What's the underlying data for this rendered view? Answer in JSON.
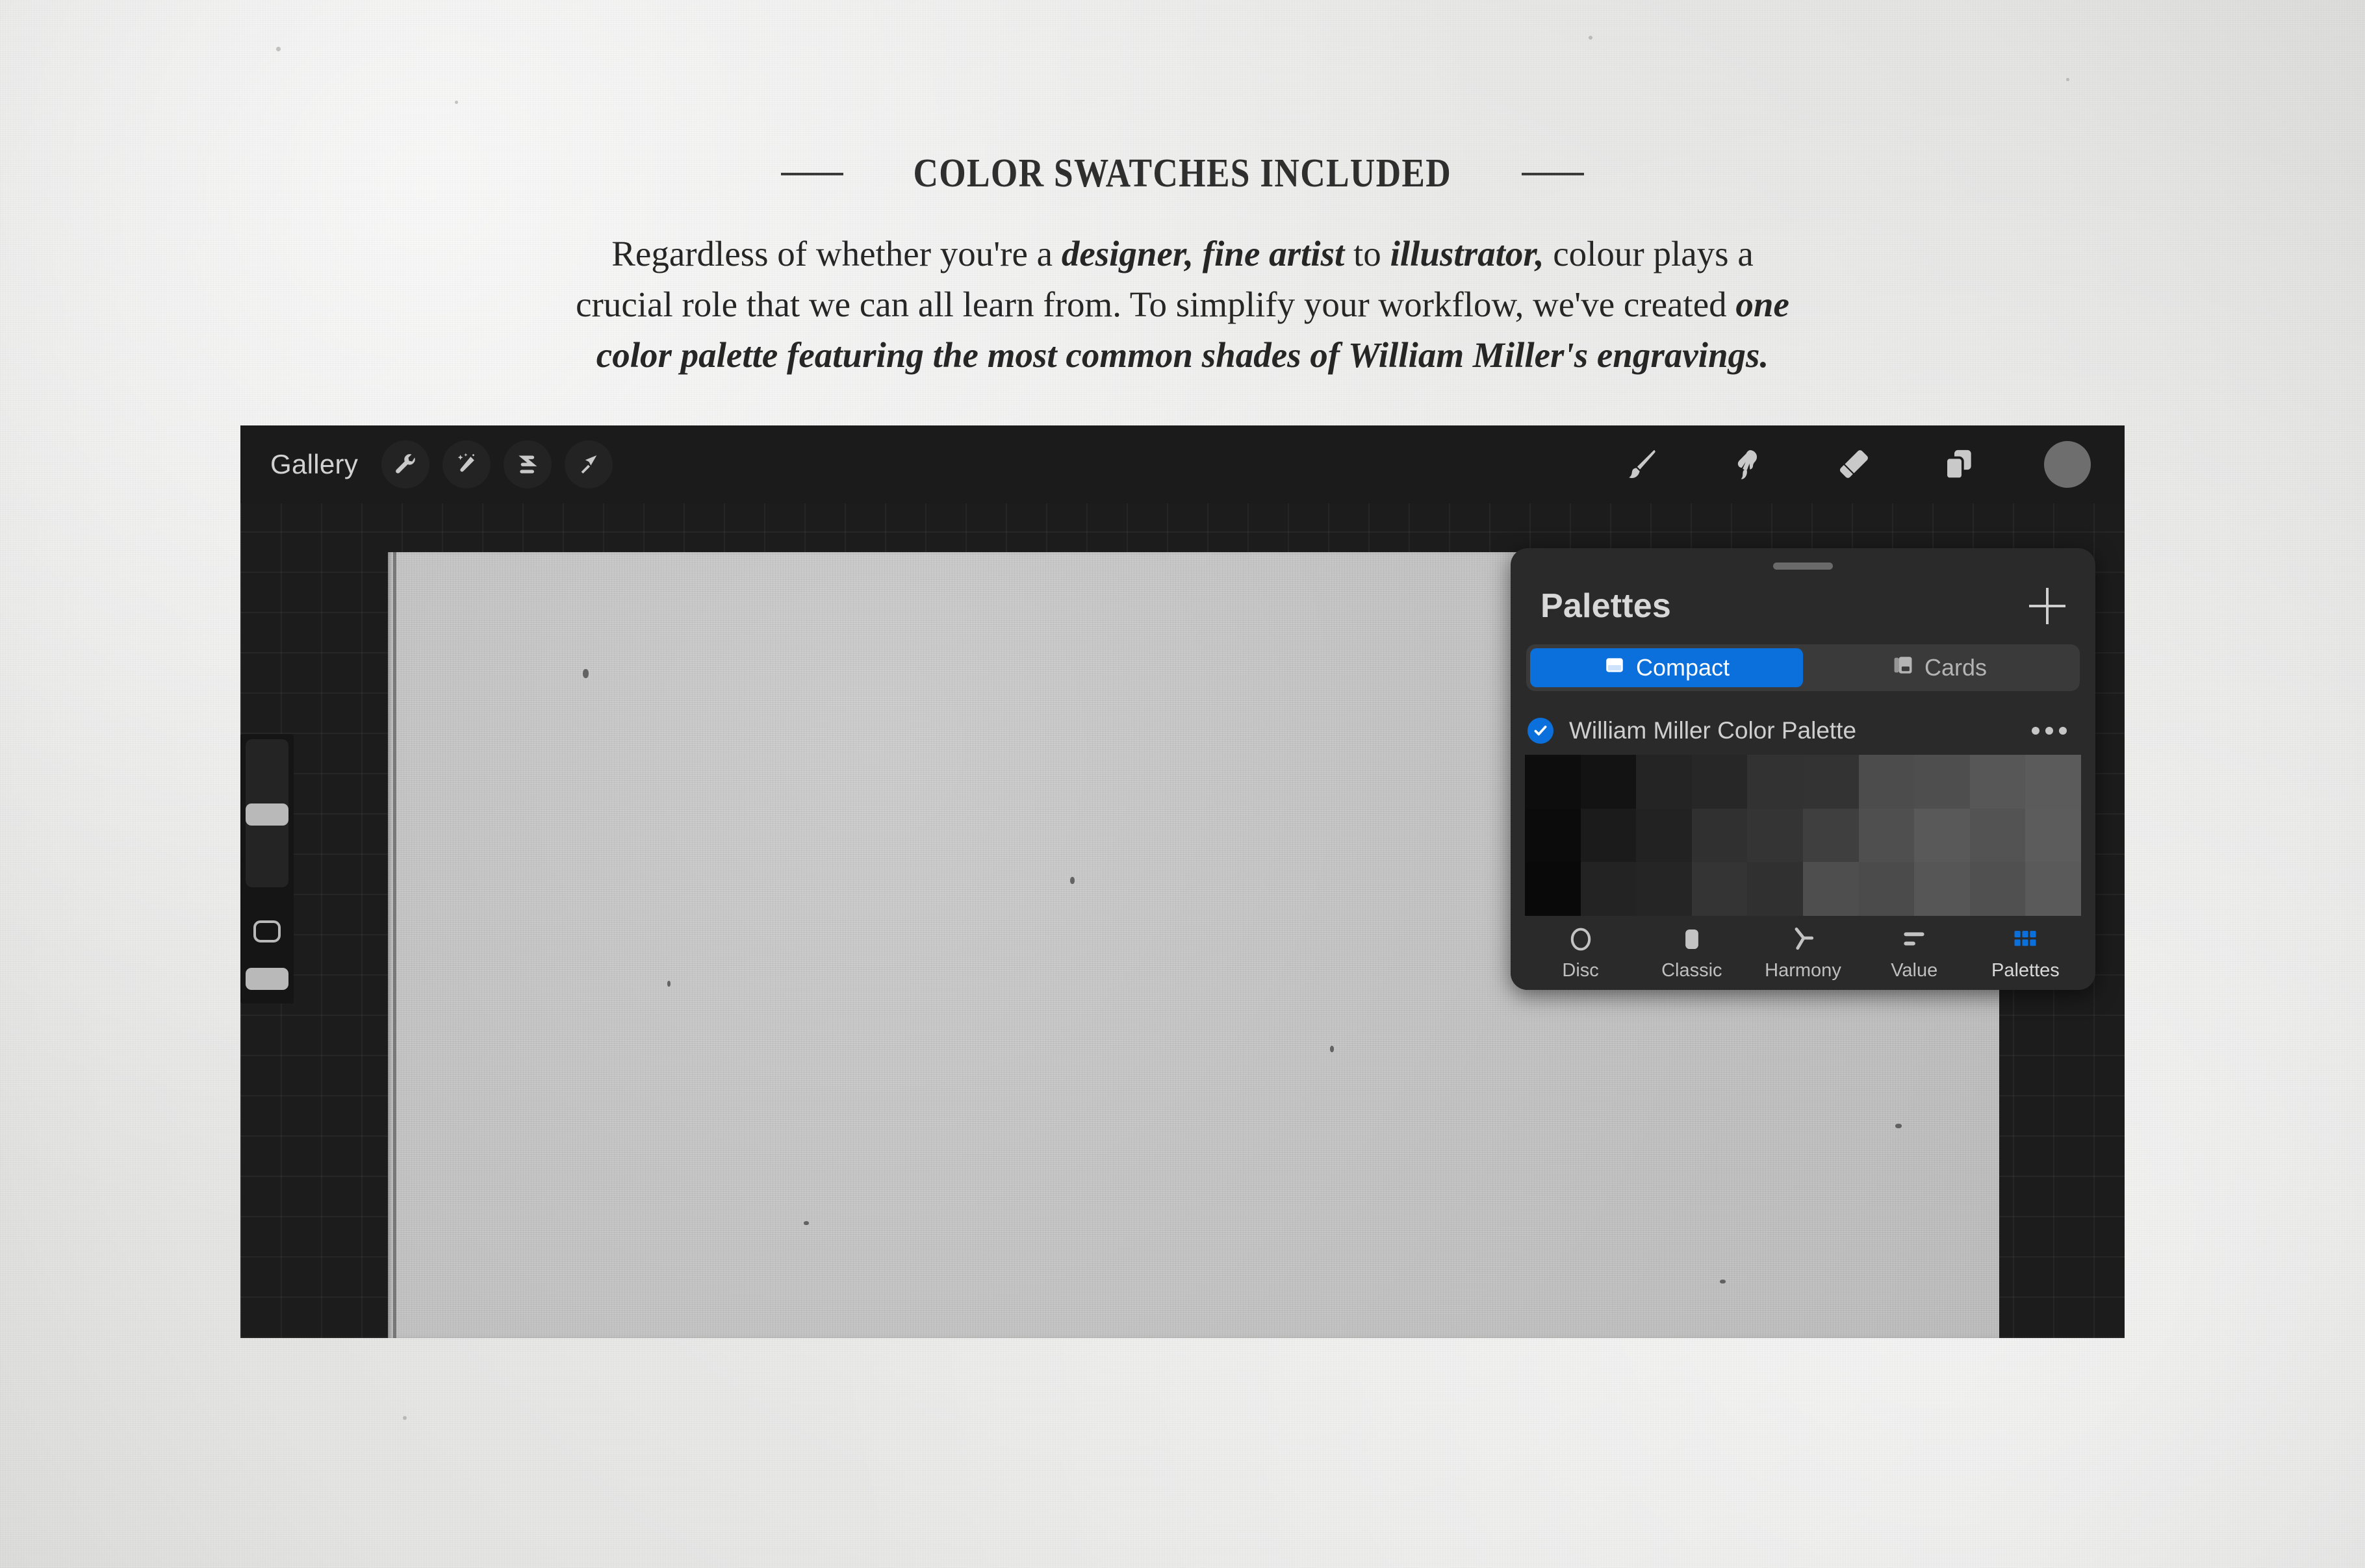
{
  "section": {
    "heading": "COLOR SWATCHES INCLUDED",
    "body_line_1_a": "Regardless of whether you're a ",
    "body_line_1_em": "designer, fine artist",
    "body_line_1_b": " to ",
    "body_line_1_em2": "illustrator,",
    "body_line_1_c": " colour plays a",
    "body_line_2_a": "crucial role that we can all learn from. To simplify your workflow, we've created ",
    "body_line_2_em": "one",
    "body_line_3_em": "color palette featuring the most common shades of William Miller's engravings."
  },
  "app": {
    "toolbar_left": {
      "gallery_label": "Gallery",
      "tools": [
        {
          "name": "actions-wrench-icon"
        },
        {
          "name": "adjustments-magic-wand-icon"
        },
        {
          "name": "selection-s-curve-icon"
        },
        {
          "name": "transform-arrow-icon"
        }
      ]
    },
    "toolbar_right": [
      {
        "name": "paintbrush-icon"
      },
      {
        "name": "smudge-icon"
      },
      {
        "name": "eraser-icon"
      },
      {
        "name": "layers-icon"
      },
      {
        "name": "color-swatch-button",
        "color": "#6e6e6e"
      }
    ]
  },
  "palettes_panel": {
    "title": "Palettes",
    "add_label": "+",
    "view_modes": [
      {
        "label": "Compact",
        "icon": "compact-view-icon",
        "active": true
      },
      {
        "label": "Cards",
        "icon": "cards-view-icon",
        "active": false
      }
    ],
    "palette": {
      "name": "William Miller Color Palette",
      "selected": true,
      "more_label": "•••"
    },
    "accent_color": "#0b6fdc",
    "swatches": [
      "#0d0d0d",
      "#131313",
      "#242424",
      "#272727",
      "#323232",
      "#333333",
      "#4c4c4c",
      "#4e4e4e",
      "#575757",
      "#5b5b5b",
      "#0b0b0b",
      "#1b1b1b",
      "#222222",
      "#303030",
      "#343434",
      "#3f3f3f",
      "#4f4f4f",
      "#595959",
      "#535353",
      "#5c5c5c",
      "#090909",
      "#232323",
      "#252525",
      "#343434",
      "#303030",
      "#4e4e4e",
      "#4b4b4b",
      "#565656",
      "#505050",
      "#5a5a5a"
    ],
    "modes": [
      {
        "label": "Disc",
        "icon": "disc-icon",
        "active": false
      },
      {
        "label": "Classic",
        "icon": "classic-square-icon",
        "active": false
      },
      {
        "label": "Harmony",
        "icon": "harmony-icon",
        "active": false
      },
      {
        "label": "Value",
        "icon": "value-sliders-icon",
        "active": false
      },
      {
        "label": "Palettes",
        "icon": "palettes-grid-icon",
        "active": true
      }
    ]
  }
}
